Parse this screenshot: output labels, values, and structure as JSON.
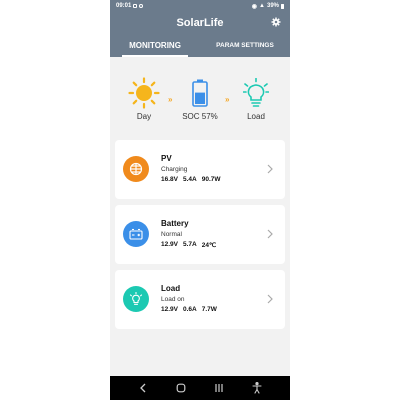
{
  "status_bar": {
    "time": "09:01",
    "battery": "39%"
  },
  "app": {
    "title": "SolarLife",
    "tabs": [
      {
        "label": "MONITORING",
        "active": true
      },
      {
        "label": "PARAM SETTINGS",
        "active": false
      }
    ]
  },
  "flow": {
    "day_label": "Day",
    "soc_label": "SOC 57%",
    "soc_percent": 57,
    "load_label": "Load",
    "arrow": "»"
  },
  "cards": [
    {
      "title": "PV",
      "status": "Charging",
      "v1": "16.8V",
      "v2": "5.4A",
      "v3": "90.7W",
      "icon": "solar-panel-icon",
      "color": "#f08a1c"
    },
    {
      "title": "Battery",
      "status": "Normal",
      "v1": "12.9V",
      "v2": "5.7A",
      "v3": "24℃",
      "icon": "battery-icon",
      "color": "#3b8fe8"
    },
    {
      "title": "Load",
      "status": "Load on",
      "v1": "12.9V",
      "v2": "0.6A",
      "v3": "7.7W",
      "icon": "bulb-icon",
      "color": "#1cc9b2"
    }
  ],
  "colors": {
    "header": "#6b7b8c",
    "sun": "#f5b51c",
    "battery": "#3b8fe8",
    "load": "#1cc9b2",
    "arrow": "#f5a623"
  }
}
